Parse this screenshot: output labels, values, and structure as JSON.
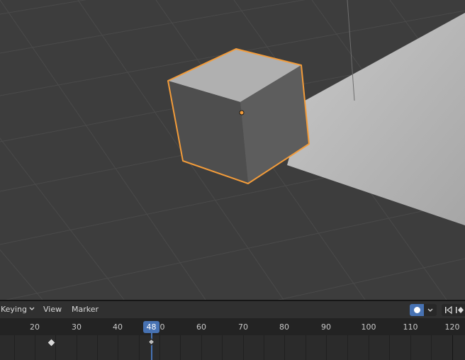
{
  "timeline": {
    "menu": {
      "keying_label": "Keying",
      "view_label": "View",
      "marker_label": "Marker"
    },
    "current_frame": "48",
    "ruler_labels": [
      "20",
      "30",
      "40",
      "0",
      "60",
      "70",
      "80",
      "90",
      "100",
      "110",
      "120"
    ]
  },
  "icons": {
    "record": "record-icon",
    "dropdown": "chevron-down-icon",
    "jump_start": "jump-to-start-icon",
    "keyframe": "keyframe-icon"
  },
  "colors": {
    "accent": "#4772b3",
    "selection_outline": "#f39c3a",
    "viewport_bg": "#3d3d3d",
    "header_bg": "#303030"
  }
}
